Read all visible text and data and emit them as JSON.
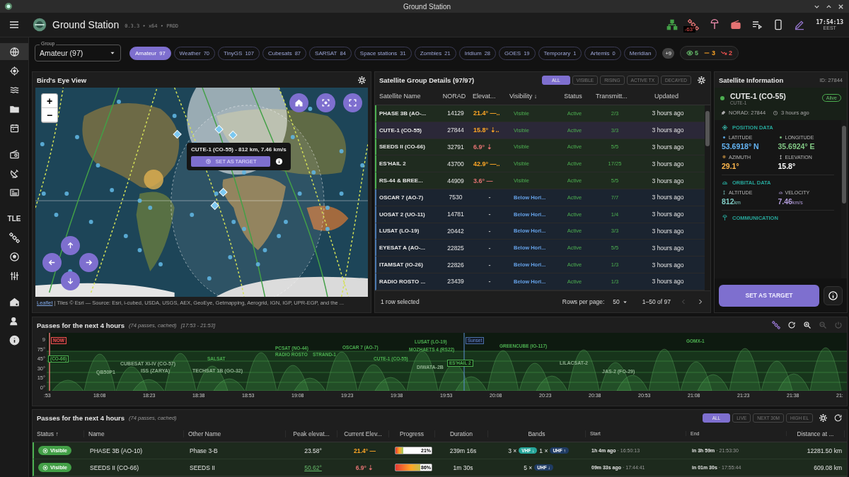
{
  "window": {
    "title": "Ground Station"
  },
  "app_bar": {
    "title": "Ground Station",
    "version": "0.3.3 • x64 • PROD",
    "temperature_badge": "-63°",
    "clock": {
      "time": "17:54:13",
      "zone": "EEST"
    }
  },
  "sidebar": {
    "items": [
      {
        "kind": "icon",
        "selected": true
      },
      {
        "kind": "icon",
        "selected": false
      },
      {
        "kind": "icon",
        "selected": false
      },
      {
        "kind": "icon",
        "selected": false
      },
      {
        "kind": "icon",
        "selected": false
      },
      {
        "kind": "icon",
        "selected": false
      },
      {
        "kind": "icon",
        "selected": false
      },
      {
        "kind": "icon",
        "selected": false
      },
      {
        "kind": "text",
        "label": "TLE",
        "selected": false
      },
      {
        "kind": "icon",
        "selected": false
      },
      {
        "kind": "icon",
        "selected": false
      },
      {
        "kind": "icon",
        "selected": false
      },
      {
        "kind": "icon",
        "selected": false
      },
      {
        "kind": "icon",
        "selected": false
      },
      {
        "kind": "icon",
        "selected": false
      }
    ]
  },
  "group_select": {
    "label": "Group",
    "value": "Amateur (97)"
  },
  "group_chips": [
    {
      "label": "Amateur",
      "count": "97",
      "selected": true
    },
    {
      "label": "Weather",
      "count": "70",
      "selected": false
    },
    {
      "label": "TinyGS",
      "count": "107",
      "selected": false
    },
    {
      "label": "Cubesats",
      "count": "87",
      "selected": false
    },
    {
      "label": "SARSAT",
      "count": "84",
      "selected": false
    },
    {
      "label": "Space stations",
      "count": "31",
      "selected": false
    },
    {
      "label": "Zombies",
      "count": "21",
      "selected": false
    },
    {
      "label": "Iridium",
      "count": "28",
      "selected": false
    },
    {
      "label": "GOES",
      "count": "19",
      "selected": false
    },
    {
      "label": "Temporary",
      "count": "1",
      "selected": false
    },
    {
      "label": "Artemis",
      "count": "0",
      "selected": false
    },
    {
      "label": "Meridian",
      "selected": false
    }
  ],
  "more_chips": "+9",
  "counters": [
    {
      "kind": "visible",
      "value": "5",
      "color": "#66bb6a"
    },
    {
      "kind": "rising",
      "value": "3",
      "color": "#ffa726"
    },
    {
      "kind": "setting",
      "value": "2",
      "color": "#ef5350"
    }
  ],
  "map": {
    "title": "Bird's Eye View",
    "zoom_in": "+",
    "zoom_out": "−",
    "tooltip": {
      "text": "CUTE-1 (CO-55) - 812 km, 7.46 km/s",
      "button": "SET AS TARGET"
    },
    "attribution": {
      "link": "Leaflet",
      "text": " | Tiles © Esri — Source: Esri, i-cubed, USDA, USGS, AEX, GeoEye, Getmapping, Aerogrid, IGN, IGP, UPR-EGP, and the ..."
    }
  },
  "group_table": {
    "title": "Satellite Group Details (97/97)",
    "filters": [
      {
        "label": "ALL",
        "selected": true
      },
      {
        "label": "VISIBLE",
        "selected": false
      },
      {
        "label": "RISING",
        "selected": false
      },
      {
        "label": "ACTIVE TX",
        "selected": false
      },
      {
        "label": "DECAYED",
        "selected": false
      }
    ],
    "columns": [
      "Satellite Name",
      "NORAD",
      "Elevat...",
      "Visibility ↓",
      "Status",
      "Transmitt...",
      "Updated"
    ],
    "rows": [
      {
        "name": "PHASE 3B (AO-...",
        "norad": "14129",
        "elevation": "21.4° —..",
        "color": "#ffa726",
        "visibility": "Visible",
        "visible": true,
        "status": "Active",
        "transmitters": "2/3",
        "updated": "3 hours ago",
        "selected": false
      },
      {
        "name": "CUTE-1 (CO-55)",
        "norad": "27844",
        "elevation": "15.8° ⇣..",
        "color": "#ffa726",
        "visibility": "Visible",
        "visible": true,
        "status": "Active",
        "transmitters": "3/3",
        "updated": "3 hours ago",
        "selected": true
      },
      {
        "name": "SEEDS II (CO-66)",
        "norad": "32791",
        "elevation": "6.9° ⇣",
        "color": "#e57373",
        "visibility": "Visible",
        "visible": true,
        "status": "Active",
        "transmitters": "5/5",
        "updated": "3 hours ago",
        "selected": false
      },
      {
        "name": "ES'HAIL 2",
        "norad": "43700",
        "elevation": "42.9° —..",
        "color": "#ffa726",
        "visibility": "Visible",
        "visible": true,
        "status": "Active",
        "transmitters": "17/25",
        "updated": "3 hours ago",
        "selected": false
      },
      {
        "name": "RS-44 & BREE...",
        "norad": "44909",
        "elevation": "3.6° —",
        "color": "#e57373",
        "visibility": "Visible",
        "visible": true,
        "status": "Active",
        "transmitters": "5/5",
        "updated": "3 hours ago",
        "selected": false
      },
      {
        "name": "OSCAR 7 (AO-7)",
        "norad": "7530",
        "elevation": "-",
        "visibility": "Below Hori...",
        "visible": false,
        "status": "Active",
        "transmitters": "7/7",
        "updated": "3 hours ago",
        "selected": false
      },
      {
        "name": "UOSAT 2 (UO-11)",
        "norad": "14781",
        "elevation": "-",
        "visibility": "Below Hori...",
        "visible": false,
        "status": "Active",
        "transmitters": "1/4",
        "updated": "3 hours ago",
        "selected": false
      },
      {
        "name": "LUSAT (LO-19)",
        "norad": "20442",
        "elevation": "-",
        "visibility": "Below Hori...",
        "visible": false,
        "status": "Active",
        "transmitters": "3/3",
        "updated": "3 hours ago",
        "selected": false
      },
      {
        "name": "EYESAT A (AO-...",
        "norad": "22825",
        "elevation": "-",
        "visibility": "Below Hori...",
        "visible": false,
        "status": "Active",
        "transmitters": "5/5",
        "updated": "3 hours ago",
        "selected": false
      },
      {
        "name": "ITAMSAT (IO-26)",
        "norad": "22826",
        "elevation": "-",
        "visibility": "Below Hori...",
        "visible": false,
        "status": "Active",
        "transmitters": "1/3",
        "updated": "3 hours ago",
        "selected": false
      },
      {
        "name": "RADIO ROSTO ...",
        "norad": "23439",
        "elevation": "-",
        "visibility": "Below Hori...",
        "visible": false,
        "status": "Active",
        "transmitters": "1/3",
        "updated": "3 hours ago",
        "selected": false
      }
    ],
    "footer": {
      "selection": "1 row selected",
      "rows_label": "Rows per page:",
      "rows_value": "50",
      "range": "1–50 of 97"
    }
  },
  "info": {
    "title": "Satellite Information",
    "id": "ID: 27844",
    "name": "CUTE-1 (CO-55)",
    "subtitle": "CUTE-1",
    "badge": "Alive",
    "norad": "NORAD: 27844",
    "updated": "3 hours ago",
    "sections": [
      {
        "title": "POSITION DATA",
        "fields": [
          {
            "label": "LATITUDE",
            "value": "53.6918° N",
            "color": "#64b5f6"
          },
          {
            "label": "LONGITUDE",
            "value": "35.6924° E",
            "color": "#81c784"
          },
          {
            "label": "AZIMUTH",
            "value": "29.1°",
            "color": "#ffb74d"
          },
          {
            "label": "ELEVATION",
            "value": "15.8°",
            "color": "#ffffff"
          }
        ]
      },
      {
        "title": "ORBITAL DATA",
        "fields": [
          {
            "label": "ALTITUDE",
            "value": "812",
            "unit": "km",
            "color": "#80cbc4"
          },
          {
            "label": "VELOCITY",
            "value": "7.46",
            "unit": "km/s",
            "color": "#b39ddb"
          }
        ]
      },
      {
        "title": "COMMUNICATION"
      }
    ],
    "button": "SET AS TARGET"
  },
  "timeline": {
    "title": "Passes for the next 4 hours",
    "subtitle": "(74 passes, cached)",
    "range": "[17:53 - 21:53]",
    "yticks": [
      "9",
      "75°",
      "45°",
      "30°",
      "15°",
      "0°"
    ],
    "xticks": [
      ":53",
      "18:08",
      "18:23",
      "18:38",
      "18:53",
      "19:08",
      "19:23",
      "19:38",
      "19:53",
      "20:08",
      "20:23",
      "20:38",
      "20:53",
      "21:08",
      "21:23",
      "21:38",
      "21:"
    ],
    "labels": [
      {
        "kind": "now",
        "text": "NOW"
      },
      {
        "kind": "boxed",
        "text": "(CO-66)"
      },
      {
        "kind": "dim",
        "text": "QB50P1"
      },
      {
        "kind": "dim",
        "text": "CUBESAT XI-IV (CO-57)"
      },
      {
        "kind": "dim",
        "text": "ISS (ZARYA)"
      },
      {
        "kind": "plain",
        "text": "SALSAT"
      },
      {
        "kind": "dim",
        "text": "TECHSAT 1B (GO-32)"
      },
      {
        "kind": "plain",
        "text": "PCSAT (NO-44)"
      },
      {
        "kind": "plain",
        "text": "RADIO ROSTO"
      },
      {
        "kind": "plain",
        "text": "STRAND-1"
      },
      {
        "kind": "plain",
        "text": "OSCAR 7 (AO-7)"
      },
      {
        "kind": "plain",
        "text": "CUTE-1 (CO-55)"
      },
      {
        "kind": "plain",
        "text": "LUSAT (LO-19)"
      },
      {
        "kind": "sunset",
        "text": "Sunset"
      },
      {
        "kind": "plain",
        "text": "MOZHAETS 4 (RS22)"
      },
      {
        "kind": "dim",
        "text": "DIWATA-2B"
      },
      {
        "kind": "boxed",
        "text": "ES'HAIL 2"
      },
      {
        "kind": "plain",
        "text": "GREENCUBE (IO-117)"
      },
      {
        "kind": "dim",
        "text": "LILACSAT-2"
      },
      {
        "kind": "dim",
        "text": "JAS-2 (FO-29)"
      },
      {
        "kind": "plain",
        "text": "GOMX-1"
      }
    ]
  },
  "passes": {
    "title": "Passes for the next 4 hours",
    "subtitle": "(74 passes, cached)",
    "filters": [
      {
        "label": "ALL",
        "selected": true
      },
      {
        "label": "LIVE",
        "selected": false
      },
      {
        "label": "NEXT 30M",
        "selected": false
      },
      {
        "label": "HIGH EL",
        "selected": false
      }
    ],
    "columns": [
      "Status ↑",
      "Name",
      "Other Name",
      "Peak elevat...",
      "Current Elev...",
      "Progress",
      "Duration",
      "Bands",
      "Start",
      "End",
      "Distance at ..."
    ],
    "rows": [
      {
        "status": "Visible",
        "name": "PHASE 3B (AO-10)",
        "other_name": "Phase 3-B",
        "peak": "23.58°",
        "peak_highlight": false,
        "current": "21.4° —",
        "color": "#ffa726",
        "level": 0.21,
        "progress": "21%",
        "duration": "239m 16s",
        "bands": [
          {
            "count": "3 ×",
            "label": "VHF ↓",
            "color": "#26a69a"
          },
          {
            "count": "1 ×",
            "label": "UHF ↑",
            "color": "#1f3b63"
          }
        ],
        "start_rel": "1h 4m ago",
        "start_time": "· 16:50:13",
        "end_rel": "in 3h 59m",
        "end_time": "· 21:53:30",
        "distance": "12281.50 km"
      },
      {
        "status": "Visible",
        "name": "SEEDS II (CO-66)",
        "other_name": "SEEDS II",
        "peak": "50.62°",
        "peak_highlight": true,
        "current": "6.9° ⇣",
        "color": "#e57373",
        "level": 0.86,
        "progress": "86%",
        "duration": "1m 30s",
        "bands": [
          {
            "count": "5 ×",
            "label": "UHF ↓",
            "color": "#1f3b63"
          }
        ],
        "start_rel": "09m 33s ago",
        "start_time": "· 17:44:41",
        "end_rel": "in 01m 30s",
        "end_time": "· 17:55:44",
        "distance": "609.08 km"
      }
    ]
  }
}
